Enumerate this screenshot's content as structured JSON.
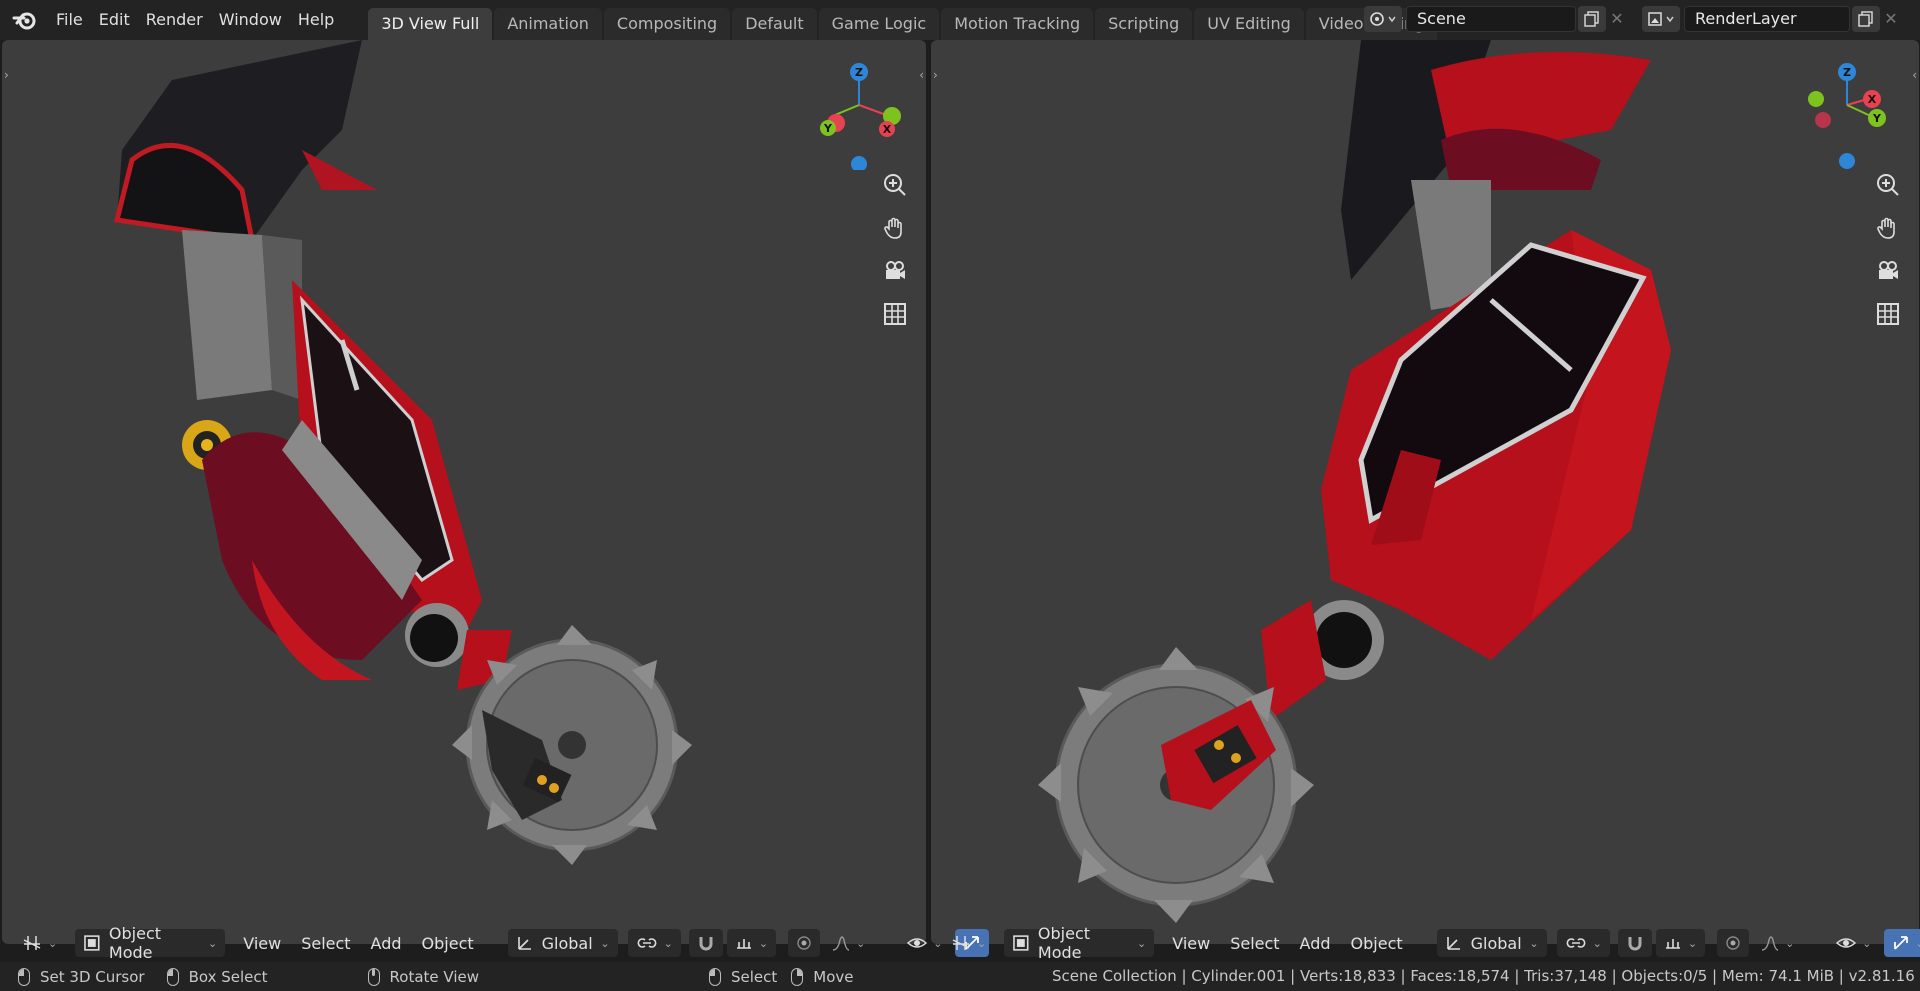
{
  "app": {
    "menus": [
      "File",
      "Edit",
      "Render",
      "Window",
      "Help"
    ]
  },
  "workspaces": {
    "tabs": [
      "3D View Full",
      "Animation",
      "Compositing",
      "Default",
      "Game Logic",
      "Motion Tracking",
      "Scripting",
      "UV Editing",
      "Video Editing"
    ],
    "active": "3D View Full",
    "add_label": "+"
  },
  "scene": {
    "name": "Scene",
    "close_label": "✕"
  },
  "view_layer": {
    "name": "RenderLayer"
  },
  "viewport_left": {
    "mode": "Object Mode",
    "menus": [
      "View",
      "Select",
      "Add",
      "Object"
    ],
    "orientation": "Global",
    "gizmo": {
      "x_label": "X",
      "y_label": "Y",
      "z_label": "Z"
    }
  },
  "viewport_right": {
    "mode": "Object Mode",
    "menus": [
      "View",
      "Select",
      "Add",
      "Object"
    ],
    "orientation": "Global",
    "gizmo": {
      "x_label": "X",
      "y_label": "Y",
      "z_label": "Z"
    }
  },
  "status": {
    "hints": [
      {
        "icon": "mouse-left-icon",
        "label": "Set 3D Cursor"
      },
      {
        "icon": "mouse-drag-icon",
        "label": "Box Select"
      },
      {
        "icon": "mouse-middle-icon",
        "label": "Rotate View"
      },
      {
        "icon": "mouse-left-icon",
        "label": "Select"
      },
      {
        "icon": "mouse-right-icon",
        "label": "Move"
      }
    ],
    "stats": "Scene Collection | Cylinder.001 | Verts:18,833 | Faces:18,574 | Tris:37,148 | Objects:0/5 | Mem: 74.1 MiB | v2.81.16"
  },
  "colors": {
    "viewport_bg": "#3d3d3d",
    "axis_x": "#e8414f",
    "axis_y": "#7ec21f",
    "axis_z": "#2e86d8",
    "active_blue": "#4772b3",
    "model_red": "#b5101b",
    "model_dark_red": "#6d0d22"
  }
}
